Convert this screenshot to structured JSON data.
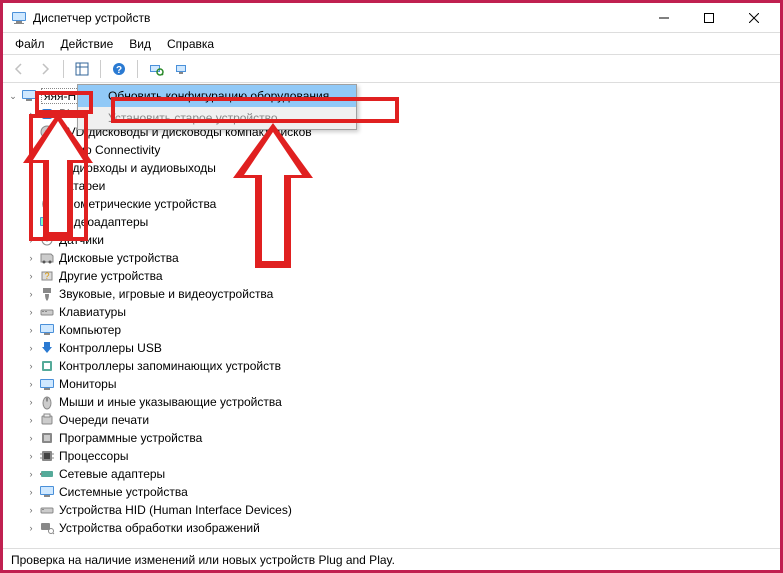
{
  "window": {
    "title": "Диспетчер устройств"
  },
  "menu": {
    "file": "Файл",
    "action": "Действие",
    "view": "Вид",
    "help": "Справка"
  },
  "tree": {
    "root": "яяя-HP",
    "items": [
      "Bluetooth",
      "DVD-дисководы и дисководы компакт-дисков",
      "Jungo Connectivity",
      "Аудиовходы и аудиовыходы",
      "Батареи",
      "Биометрические устройства",
      "Видеоадаптеры",
      "Датчики",
      "Дисковые устройства",
      "Другие устройства",
      "Звуковые, игровые и видеоустройства",
      "Клавиатуры",
      "Компьютер",
      "Контроллеры USB",
      "Контроллеры запоминающих устройств",
      "Мониторы",
      "Мыши и иные указывающие устройства",
      "Очереди печати",
      "Программные устройства",
      "Процессоры",
      "Сетевые адаптеры",
      "Системные устройства",
      "Устройства HID (Human Interface Devices)",
      "Устройства обработки изображений"
    ]
  },
  "context_menu": {
    "item1": "Обновить конфигурацию оборудования",
    "item2": "Установить старое устройство"
  },
  "status": "Проверка на наличие изменений или новых устройств Plug and Play."
}
